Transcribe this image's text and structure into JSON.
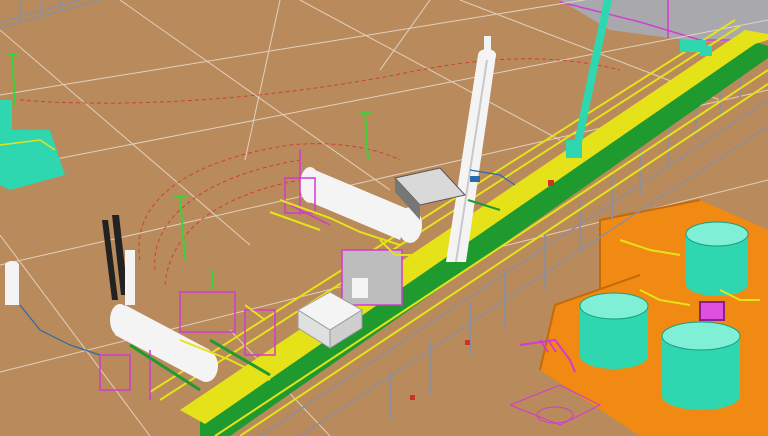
{
  "viewport": {
    "view_type": "3D plant model view (isometric)",
    "colors": {
      "ground": "#b98a5c",
      "paved_area": "#a9a9ad",
      "grid_lines": "#e9ddcf",
      "equipment_white": "#f4f4f4",
      "equipment_cyan": "#2fd7b0",
      "pipe_rack_yellow": "#e6e21a",
      "pipe_rack_green": "#1f9a2e",
      "rack_steel": "#8f8f99",
      "tank_pad_orange": "#f08a12",
      "piping_magenta": "#d23ad2",
      "piping_red": "#d0302a"
    }
  }
}
